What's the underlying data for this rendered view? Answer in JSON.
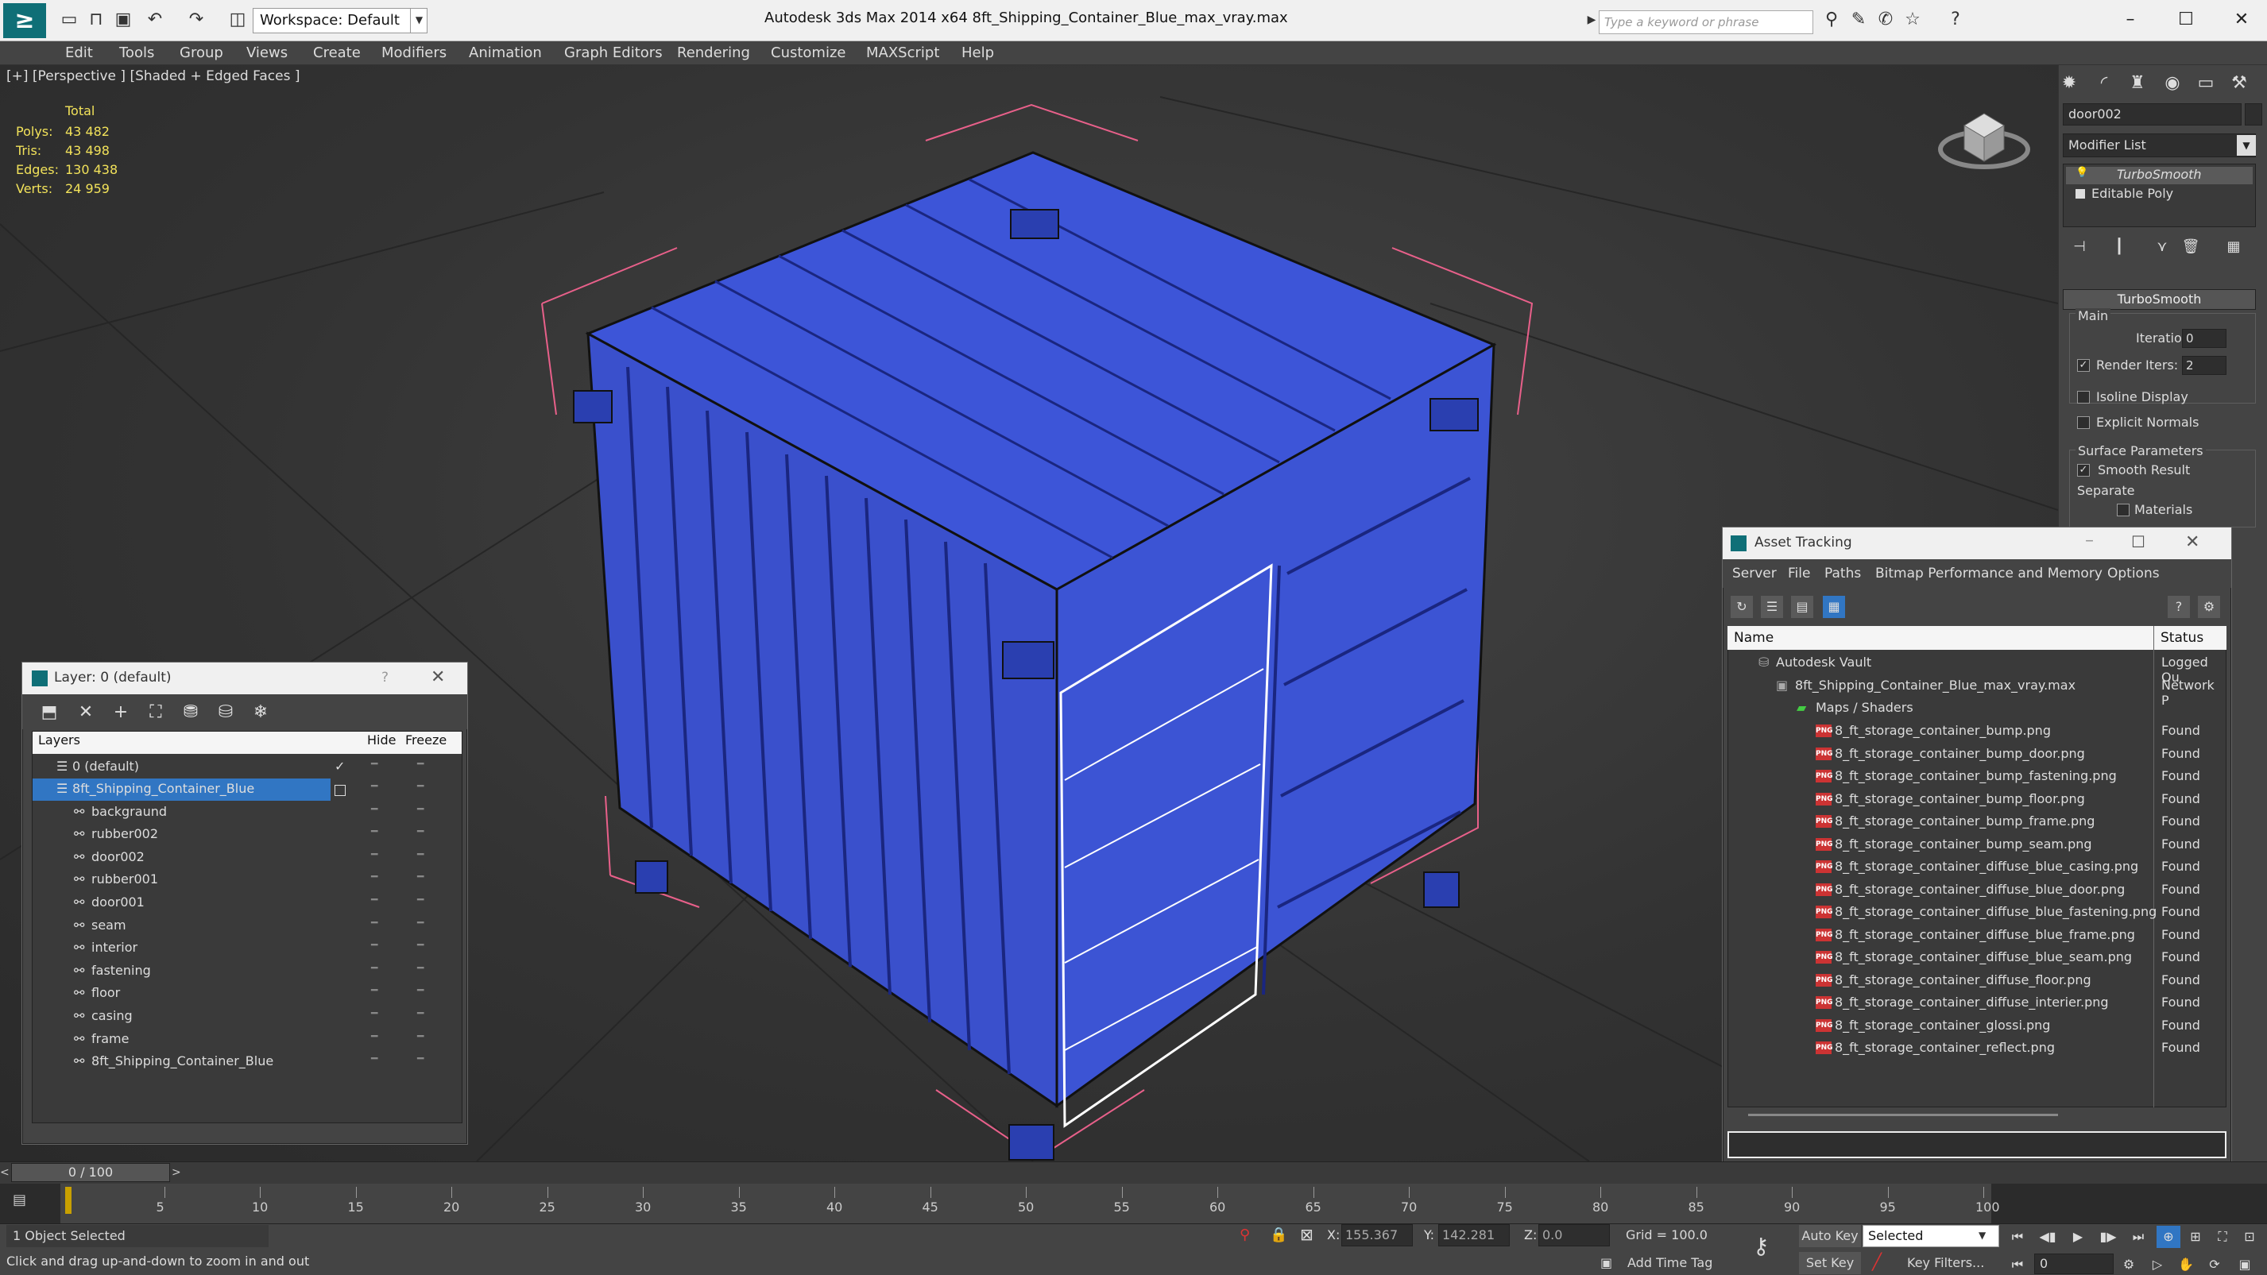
{
  "titlebar": {
    "workspace": "Workspace: Default",
    "app_title": "Autodesk 3ds Max  2014 x64     8ft_Shipping_Container_Blue_max_vray.max",
    "search_placeholder": "Type a keyword or phrase"
  },
  "menu": [
    "Edit",
    "Tools",
    "Group",
    "Views",
    "Create",
    "Modifiers",
    "Animation",
    "Graph Editors",
    "Rendering",
    "Customize",
    "MAXScript",
    "Help"
  ],
  "viewport": {
    "label": "[+] [Perspective ] [Shaded + Edged Faces ]",
    "stats_title": "Total",
    "stats": [
      {
        "k": "Polys:",
        "v": "43 482"
      },
      {
        "k": "Tris:",
        "v": "43 498"
      },
      {
        "k": "Edges:",
        "v": "130 438"
      },
      {
        "k": "Verts:",
        "v": "24 959"
      }
    ]
  },
  "command_panel": {
    "object_name": "door002",
    "modifier_list": "Modifier List",
    "stack": [
      "TurboSmooth",
      "Editable Poly"
    ],
    "rollout": "TurboSmooth",
    "main_label": "Main",
    "iterations_label": "Iterations:",
    "iterations_value": "0",
    "render_iters_label": "Render Iters:",
    "render_iters_value": "2",
    "isoline": "Isoline Display",
    "explicit": "Explicit Normals",
    "surface_label": "Surface Parameters",
    "smooth_result": "Smooth Result",
    "separate_label": "Separate",
    "materials": "Materials"
  },
  "layer_window": {
    "title": "Layer: 0 (default)",
    "help": "?",
    "col_layers": "Layers",
    "col_hide": "Hide",
    "col_freeze": "Freeze",
    "rows": [
      "0 (default)",
      "8ft_Shipping_Container_Blue",
      "backgraund",
      "rubber002",
      "door002",
      "rubber001",
      "door001",
      "seam",
      "interior",
      "fastening",
      "floor",
      "casing",
      "frame",
      "8ft_Shipping_Container_Blue"
    ]
  },
  "asset_tracking": {
    "title": "Asset Tracking",
    "menu": [
      "Server",
      "File",
      "Paths",
      "Bitmap Performance and Memory",
      "Options"
    ],
    "col_name": "Name",
    "col_status": "Status",
    "vault": {
      "name": "Autodesk Vault",
      "status": "Logged Ou"
    },
    "file": {
      "name": "8ft_Shipping_Container_Blue_max_vray.max",
      "status": "Network P"
    },
    "maps_folder": "Maps / Shaders",
    "png_badge": "PNG",
    "maps": [
      {
        "name": "8_ft_storage_container_bump.png",
        "status": "Found"
      },
      {
        "name": "8_ft_storage_container_bump_door.png",
        "status": "Found"
      },
      {
        "name": "8_ft_storage_container_bump_fastening.png",
        "status": "Found"
      },
      {
        "name": "8_ft_storage_container_bump_floor.png",
        "status": "Found"
      },
      {
        "name": "8_ft_storage_container_bump_frame.png",
        "status": "Found"
      },
      {
        "name": "8_ft_storage_container_bump_seam.png",
        "status": "Found"
      },
      {
        "name": "8_ft_storage_container_diffuse_blue_casing.png",
        "status": "Found"
      },
      {
        "name": "8_ft_storage_container_diffuse_blue_door.png",
        "status": "Found"
      },
      {
        "name": "8_ft_storage_container_diffuse_blue_fastening.png",
        "status": "Found"
      },
      {
        "name": "8_ft_storage_container_diffuse_blue_frame.png",
        "status": "Found"
      },
      {
        "name": "8_ft_storage_container_diffuse_blue_seam.png",
        "status": "Found"
      },
      {
        "name": "8_ft_storage_container_diffuse_floor.png",
        "status": "Found"
      },
      {
        "name": "8_ft_storage_container_diffuse_interier.png",
        "status": "Found"
      },
      {
        "name": "8_ft_storage_container_glossi.png",
        "status": "Found"
      },
      {
        "name": "8_ft_storage_container_reflect.png",
        "status": "Found"
      }
    ]
  },
  "timeline": {
    "frame_display": "0 / 100",
    "ticks": [
      "5",
      "10",
      "15",
      "20",
      "25",
      "30",
      "35",
      "40",
      "45",
      "50",
      "55",
      "60",
      "65",
      "70",
      "75",
      "80",
      "85",
      "90",
      "95",
      "100"
    ],
    "tick_frames": [
      5,
      10,
      15,
      20,
      25,
      30,
      35,
      40,
      45,
      50,
      55,
      60,
      65,
      70,
      75,
      80,
      85,
      90,
      95,
      100
    ]
  },
  "status": {
    "selection": "1 Object Selected",
    "hint": "Click and drag up-and-down to zoom in and out",
    "x_label": "X:",
    "x_value": "155.367",
    "y_label": "Y:",
    "y_value": "142.281",
    "z_label": "Z:",
    "z_value": "0.0",
    "grid": "Grid = 100.0",
    "add_time_tag": "Add Time Tag",
    "auto_key": "Auto Key",
    "set_key": "Set Key",
    "selected": "Selected",
    "key_filters": "Key Filters...",
    "frame_value": "0"
  },
  "colors": {
    "container": "#3d55d8",
    "selection": "#3176c3",
    "stats": "#f2e25a"
  }
}
